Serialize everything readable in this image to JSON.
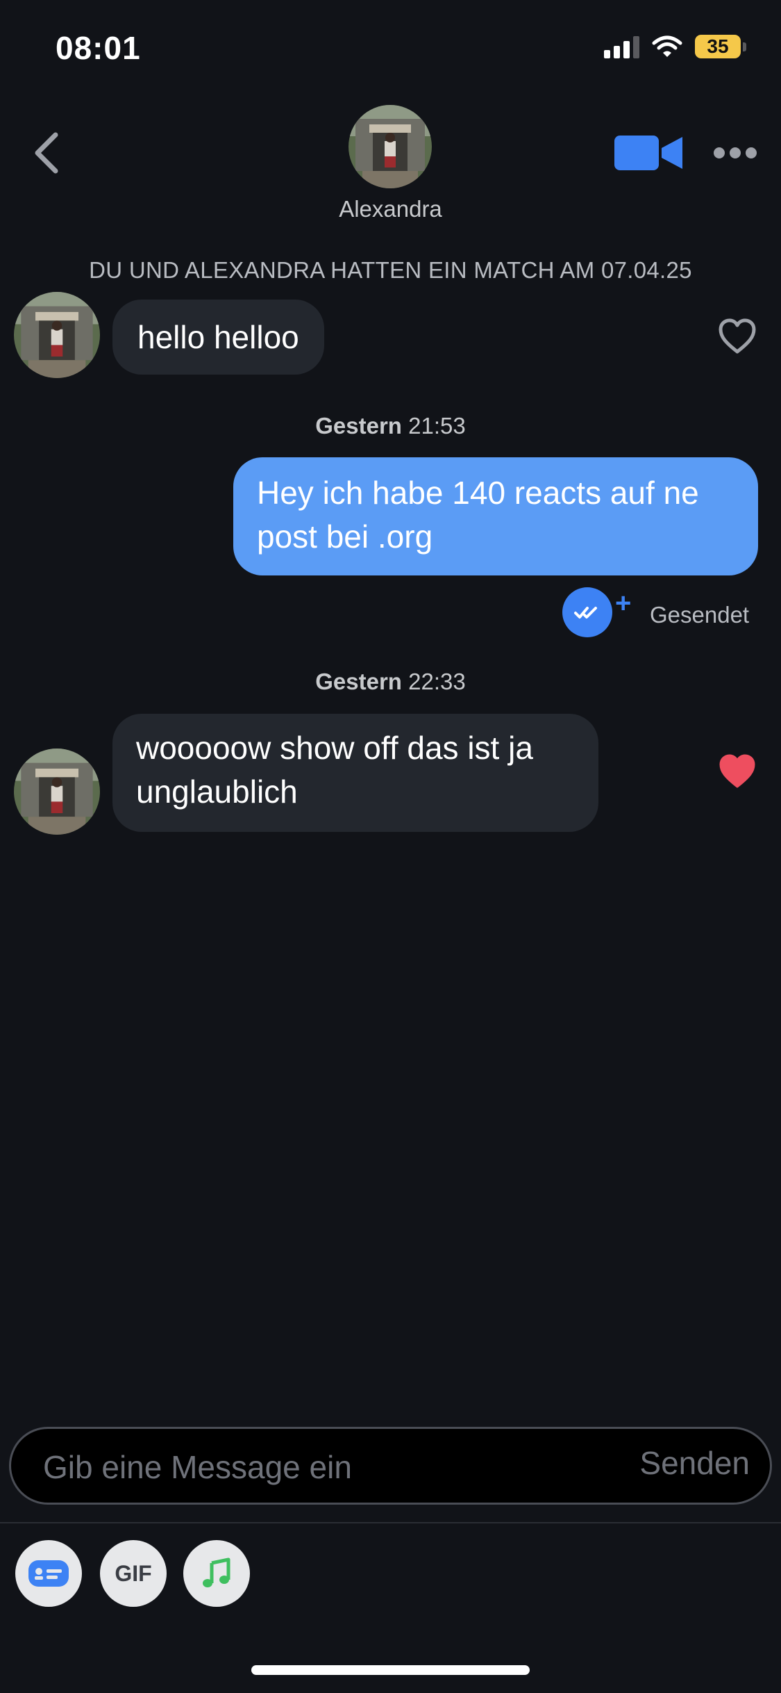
{
  "status_bar": {
    "time": "08:01",
    "battery": "35"
  },
  "header": {
    "name": "Alexandra"
  },
  "match_banner": "DU UND ALEXANDRA HATTEN EIN MATCH AM 07.04.25",
  "messages": [
    {
      "text": "hello helloo",
      "liked": false
    },
    {
      "day": "Gestern",
      "time": "21:53",
      "text": "Hey ich habe 140 reacts auf ne post bei .org",
      "status": "Gesendet"
    },
    {
      "day": "Gestern",
      "time": "22:33",
      "text": "wooooow show off das ist ja unglaublich",
      "liked": true
    }
  ],
  "composer": {
    "placeholder": "Gib eine Message ein",
    "send_label": "Senden"
  },
  "toolbar": {
    "gif_label": "GIF"
  },
  "colors": {
    "accent": "#3d82f4",
    "outgoing_bubble": "#5b9cf5",
    "incoming_bubble": "#23272e",
    "like": "#ee4e5f",
    "background": "#111318"
  }
}
